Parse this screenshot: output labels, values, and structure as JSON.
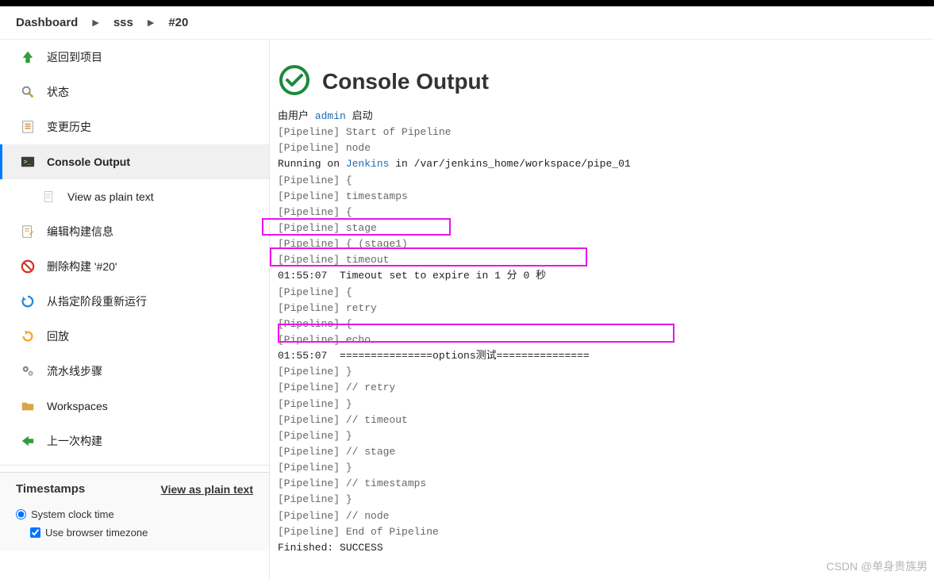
{
  "breadcrumbs": {
    "items": [
      "Dashboard",
      "sss",
      "#20"
    ]
  },
  "sidebar": {
    "items": [
      {
        "id": "back",
        "label": "返回到项目",
        "icon": "arrow-up-green"
      },
      {
        "id": "status",
        "label": "状态",
        "icon": "magnifier"
      },
      {
        "id": "changes",
        "label": "变更历史",
        "icon": "doc-list"
      },
      {
        "id": "console",
        "label": "Console Output",
        "icon": "terminal",
        "active": true
      },
      {
        "id": "plain",
        "label": "View as plain text",
        "icon": "doc",
        "sub": true
      },
      {
        "id": "edit",
        "label": "编辑构建信息",
        "icon": "doc-pencil"
      },
      {
        "id": "delete",
        "label": "删除构建 '#20'",
        "icon": "no-entry"
      },
      {
        "id": "restart",
        "label": "从指定阶段重新运行",
        "icon": "refresh-blue"
      },
      {
        "id": "replay",
        "label": "回放",
        "icon": "redo-orange"
      },
      {
        "id": "steps",
        "label": "流水线步骤",
        "icon": "gears"
      },
      {
        "id": "workspaces",
        "label": "Workspaces",
        "icon": "folder"
      },
      {
        "id": "prev",
        "label": "上一次构建",
        "icon": "arrow-left-green"
      }
    ]
  },
  "timestamps": {
    "title": "Timestamps",
    "link": "View as plain text",
    "opt_clock": "System clock time",
    "opt_tz": "Use browser timezone"
  },
  "main": {
    "title": "Console Output",
    "start_prefix": "由用户 ",
    "start_user": "admin",
    "start_suffix": " 启动",
    "running_prefix": "Running on ",
    "running_node": "Jenkins",
    "running_suffix": " in /var/jenkins_home/workspace/pipe_01",
    "lines": {
      "l1": "[Pipeline] Start of Pipeline",
      "l2": "[Pipeline] node",
      "l3": "[Pipeline] {",
      "l4": "[Pipeline] timestamps",
      "l5": "[Pipeline] {",
      "l6": "[Pipeline] stage",
      "l7": "[Pipeline] { (stage1)",
      "l8": "[Pipeline] timeout",
      "ts1_time": "01:55:07",
      "ts1_msg": "Timeout set to expire in 1 分 0 秒",
      "l9": "[Pipeline] {",
      "l10": "[Pipeline] retry",
      "l11": "[Pipeline] {",
      "l12": "[Pipeline] echo",
      "ts2_time": "01:55:07",
      "ts2_msg": "===============options测试===============",
      "l13": "[Pipeline] }",
      "l14": "[Pipeline] // retry",
      "l15": "[Pipeline] }",
      "l16": "[Pipeline] // timeout",
      "l17": "[Pipeline] }",
      "l18": "[Pipeline] // stage",
      "l19": "[Pipeline] }",
      "l20": "[Pipeline] // timestamps",
      "l21": "[Pipeline] }",
      "l22": "[Pipeline] // node",
      "l23": "[Pipeline] End of Pipeline",
      "finished": "Finished: SUCCESS"
    }
  },
  "watermark": "CSDN @单身贵族男"
}
